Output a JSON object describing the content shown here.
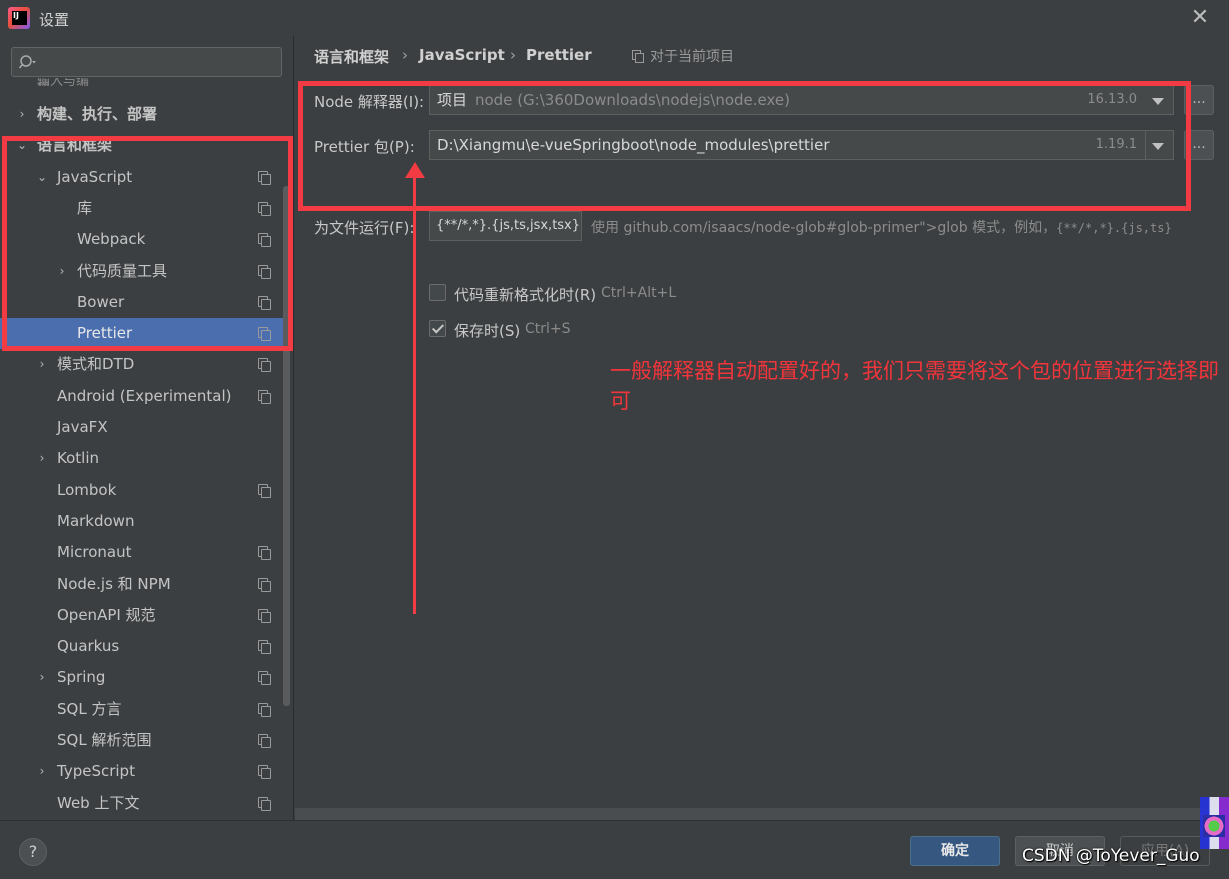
{
  "window": {
    "title": "设置"
  },
  "sidebar": {
    "search_placeholder": "",
    "partial_top": "输入与编辑",
    "items": [
      {
        "label": "构建、执行、部署",
        "arrow": "›",
        "bold": true,
        "copy": false
      },
      {
        "label": "语言和框架",
        "arrow": "⌄",
        "bold": true,
        "copy": false
      },
      {
        "label": "JavaScript",
        "arrow": "⌄",
        "bold": false,
        "copy": true
      },
      {
        "label": "库",
        "arrow": "",
        "bold": false,
        "copy": true
      },
      {
        "label": "Webpack",
        "arrow": "",
        "bold": false,
        "copy": true
      },
      {
        "label": "代码质量工具",
        "arrow": "›",
        "bold": false,
        "copy": true
      },
      {
        "label": "Bower",
        "arrow": "",
        "bold": false,
        "copy": true
      },
      {
        "label": "Prettier",
        "arrow": "",
        "bold": false,
        "copy": true,
        "selected": true
      },
      {
        "label": "模式和DTD",
        "arrow": "›",
        "bold": false,
        "copy": true
      },
      {
        "label": "Android (Experimental)",
        "arrow": "",
        "bold": false,
        "copy": true
      },
      {
        "label": "JavaFX",
        "arrow": "",
        "bold": false,
        "copy": false
      },
      {
        "label": "Kotlin",
        "arrow": "›",
        "bold": false,
        "copy": false
      },
      {
        "label": "Lombok",
        "arrow": "",
        "bold": false,
        "copy": true
      },
      {
        "label": "Markdown",
        "arrow": "",
        "bold": false,
        "copy": false
      },
      {
        "label": "Micronaut",
        "arrow": "",
        "bold": false,
        "copy": true
      },
      {
        "label": "Node.js 和 NPM",
        "arrow": "",
        "bold": false,
        "copy": true
      },
      {
        "label": "OpenAPI 规范",
        "arrow": "",
        "bold": false,
        "copy": true
      },
      {
        "label": "Quarkus",
        "arrow": "",
        "bold": false,
        "copy": true
      },
      {
        "label": "Spring",
        "arrow": "›",
        "bold": false,
        "copy": true
      },
      {
        "label": "SQL 方言",
        "arrow": "",
        "bold": false,
        "copy": true
      },
      {
        "label": "SQL 解析范围",
        "arrow": "",
        "bold": false,
        "copy": true
      },
      {
        "label": "TypeScript",
        "arrow": "›",
        "bold": false,
        "copy": true
      },
      {
        "label": "Web 上下文",
        "arrow": "",
        "bold": false,
        "copy": true
      }
    ]
  },
  "breadcrumb": {
    "parts": [
      "语言和框架",
      "JavaScript",
      "Prettier"
    ],
    "separator": "›",
    "scope": "对于当前项目"
  },
  "form": {
    "node_label": "Node 解释器(I):",
    "node_prefix": "项目",
    "node_path": "node (G:\\360Downloads\\nodejs\\node.exe)",
    "node_version": "16.13.0",
    "prettier_label": "Prettier 包(P):",
    "prettier_path": "D:\\Xiangmu\\e-vueSpringboot\\node_modules\\prettier",
    "prettier_version": "1.19.1",
    "browse_label": "...",
    "run_label": "为文件运行(F):",
    "run_pattern": "{**/*,*}.{js,ts,jsx,tsx}",
    "run_hint_text": "使用 github.com/isaacs/node-glob#glob-primer\">glob 模式，例如，",
    "run_hint_code": "{**/*,*}.{js,ts}",
    "reformat_label": "代码重新格式化时(R)",
    "reformat_shortcut": "Ctrl+Alt+L",
    "reformat_checked": false,
    "save_label": "保存时(S)",
    "save_shortcut": "Ctrl+S",
    "save_checked": true
  },
  "annotation": {
    "text": "一般解释器自动配置好的，我们只需要将这个包的位置进行选择即可",
    "color": "#f2343b"
  },
  "footer": {
    "help": "?",
    "ok": "确定",
    "cancel": "取消",
    "apply": "应用(A)"
  },
  "watermark": "CSDN @ToYever_Guo"
}
